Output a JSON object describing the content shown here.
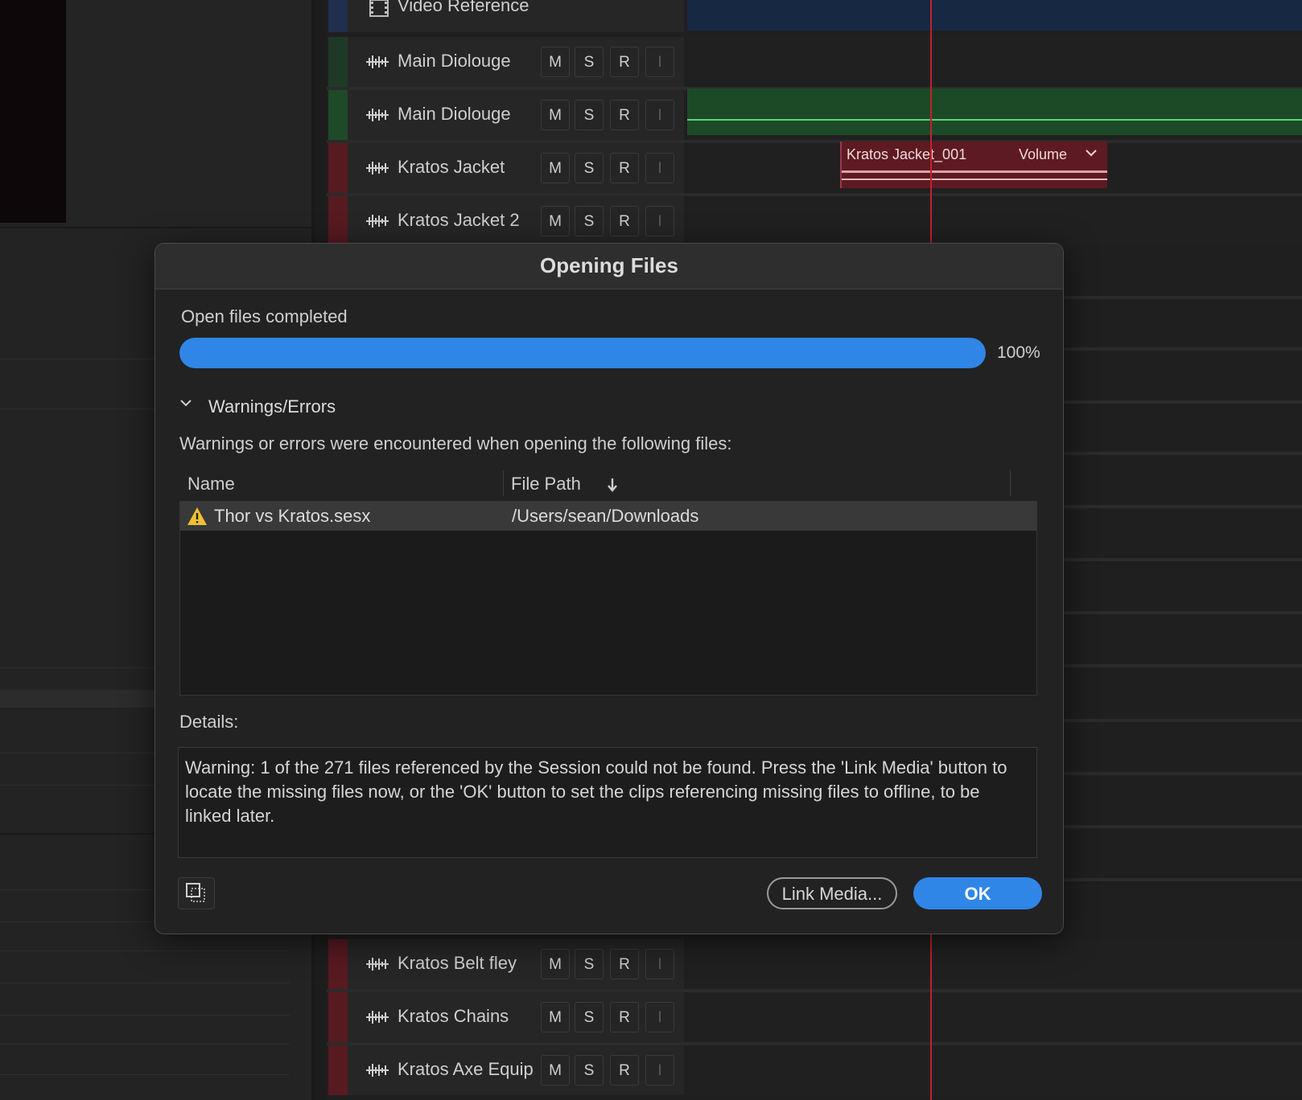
{
  "tracks_top": {
    "video_reference": "Video Reference",
    "rows": [
      {
        "name": "Main Diolouge",
        "m": "M",
        "s": "S",
        "r": "R",
        "i": "I",
        "color": "#1e3a27"
      },
      {
        "name": "Main Diolouge",
        "m": "M",
        "s": "S",
        "r": "R",
        "i": "I",
        "color": "#1f4a29"
      },
      {
        "name": "Kratos Jacket",
        "m": "M",
        "s": "S",
        "r": "R",
        "i": "I",
        "color": "#571a20"
      },
      {
        "name": "Kratos Jacket 2",
        "m": "M",
        "s": "S",
        "r": "R",
        "i": "I",
        "color": "#571a20"
      }
    ]
  },
  "tracks_bottom": {
    "rows": [
      {
        "name": "Kratos Belt fley",
        "m": "M",
        "s": "S",
        "r": "R",
        "i": "I",
        "color": "#571a20"
      },
      {
        "name": "Kratos Chains",
        "m": "M",
        "s": "S",
        "r": "R",
        "i": "I",
        "color": "#571a20"
      },
      {
        "name": "Kratos Axe Equip",
        "m": "M",
        "s": "S",
        "r": "R",
        "i": "I",
        "color": "#571a20"
      }
    ]
  },
  "clip": {
    "name": "Kratos Jacket_001",
    "param": "Volume"
  },
  "dialog": {
    "title": "Opening Files",
    "status": "Open files completed",
    "progress_percent": 100,
    "progress_label": "100%",
    "warnings_heading": "Warnings/Errors",
    "warnings_description": "Warnings or errors were encountered when opening the following files:",
    "columns": {
      "name": "Name",
      "path": "File Path"
    },
    "files": [
      {
        "name": "Thor vs Kratos.sesx",
        "path": "/Users/sean/Downloads"
      }
    ],
    "details_label": "Details:",
    "details_text": "Warning: 1 of the 271 files referenced by the Session could not be found. Press the 'Link Media' button to locate the missing files now, or the 'OK' button to set the clips referencing missing files to offline, to be linked later.",
    "link_media_label": "Link Media...",
    "ok_label": "OK"
  },
  "colors": {
    "accent": "#2f86e6",
    "playhead": "#c0232c",
    "warning": "#f0c030"
  }
}
